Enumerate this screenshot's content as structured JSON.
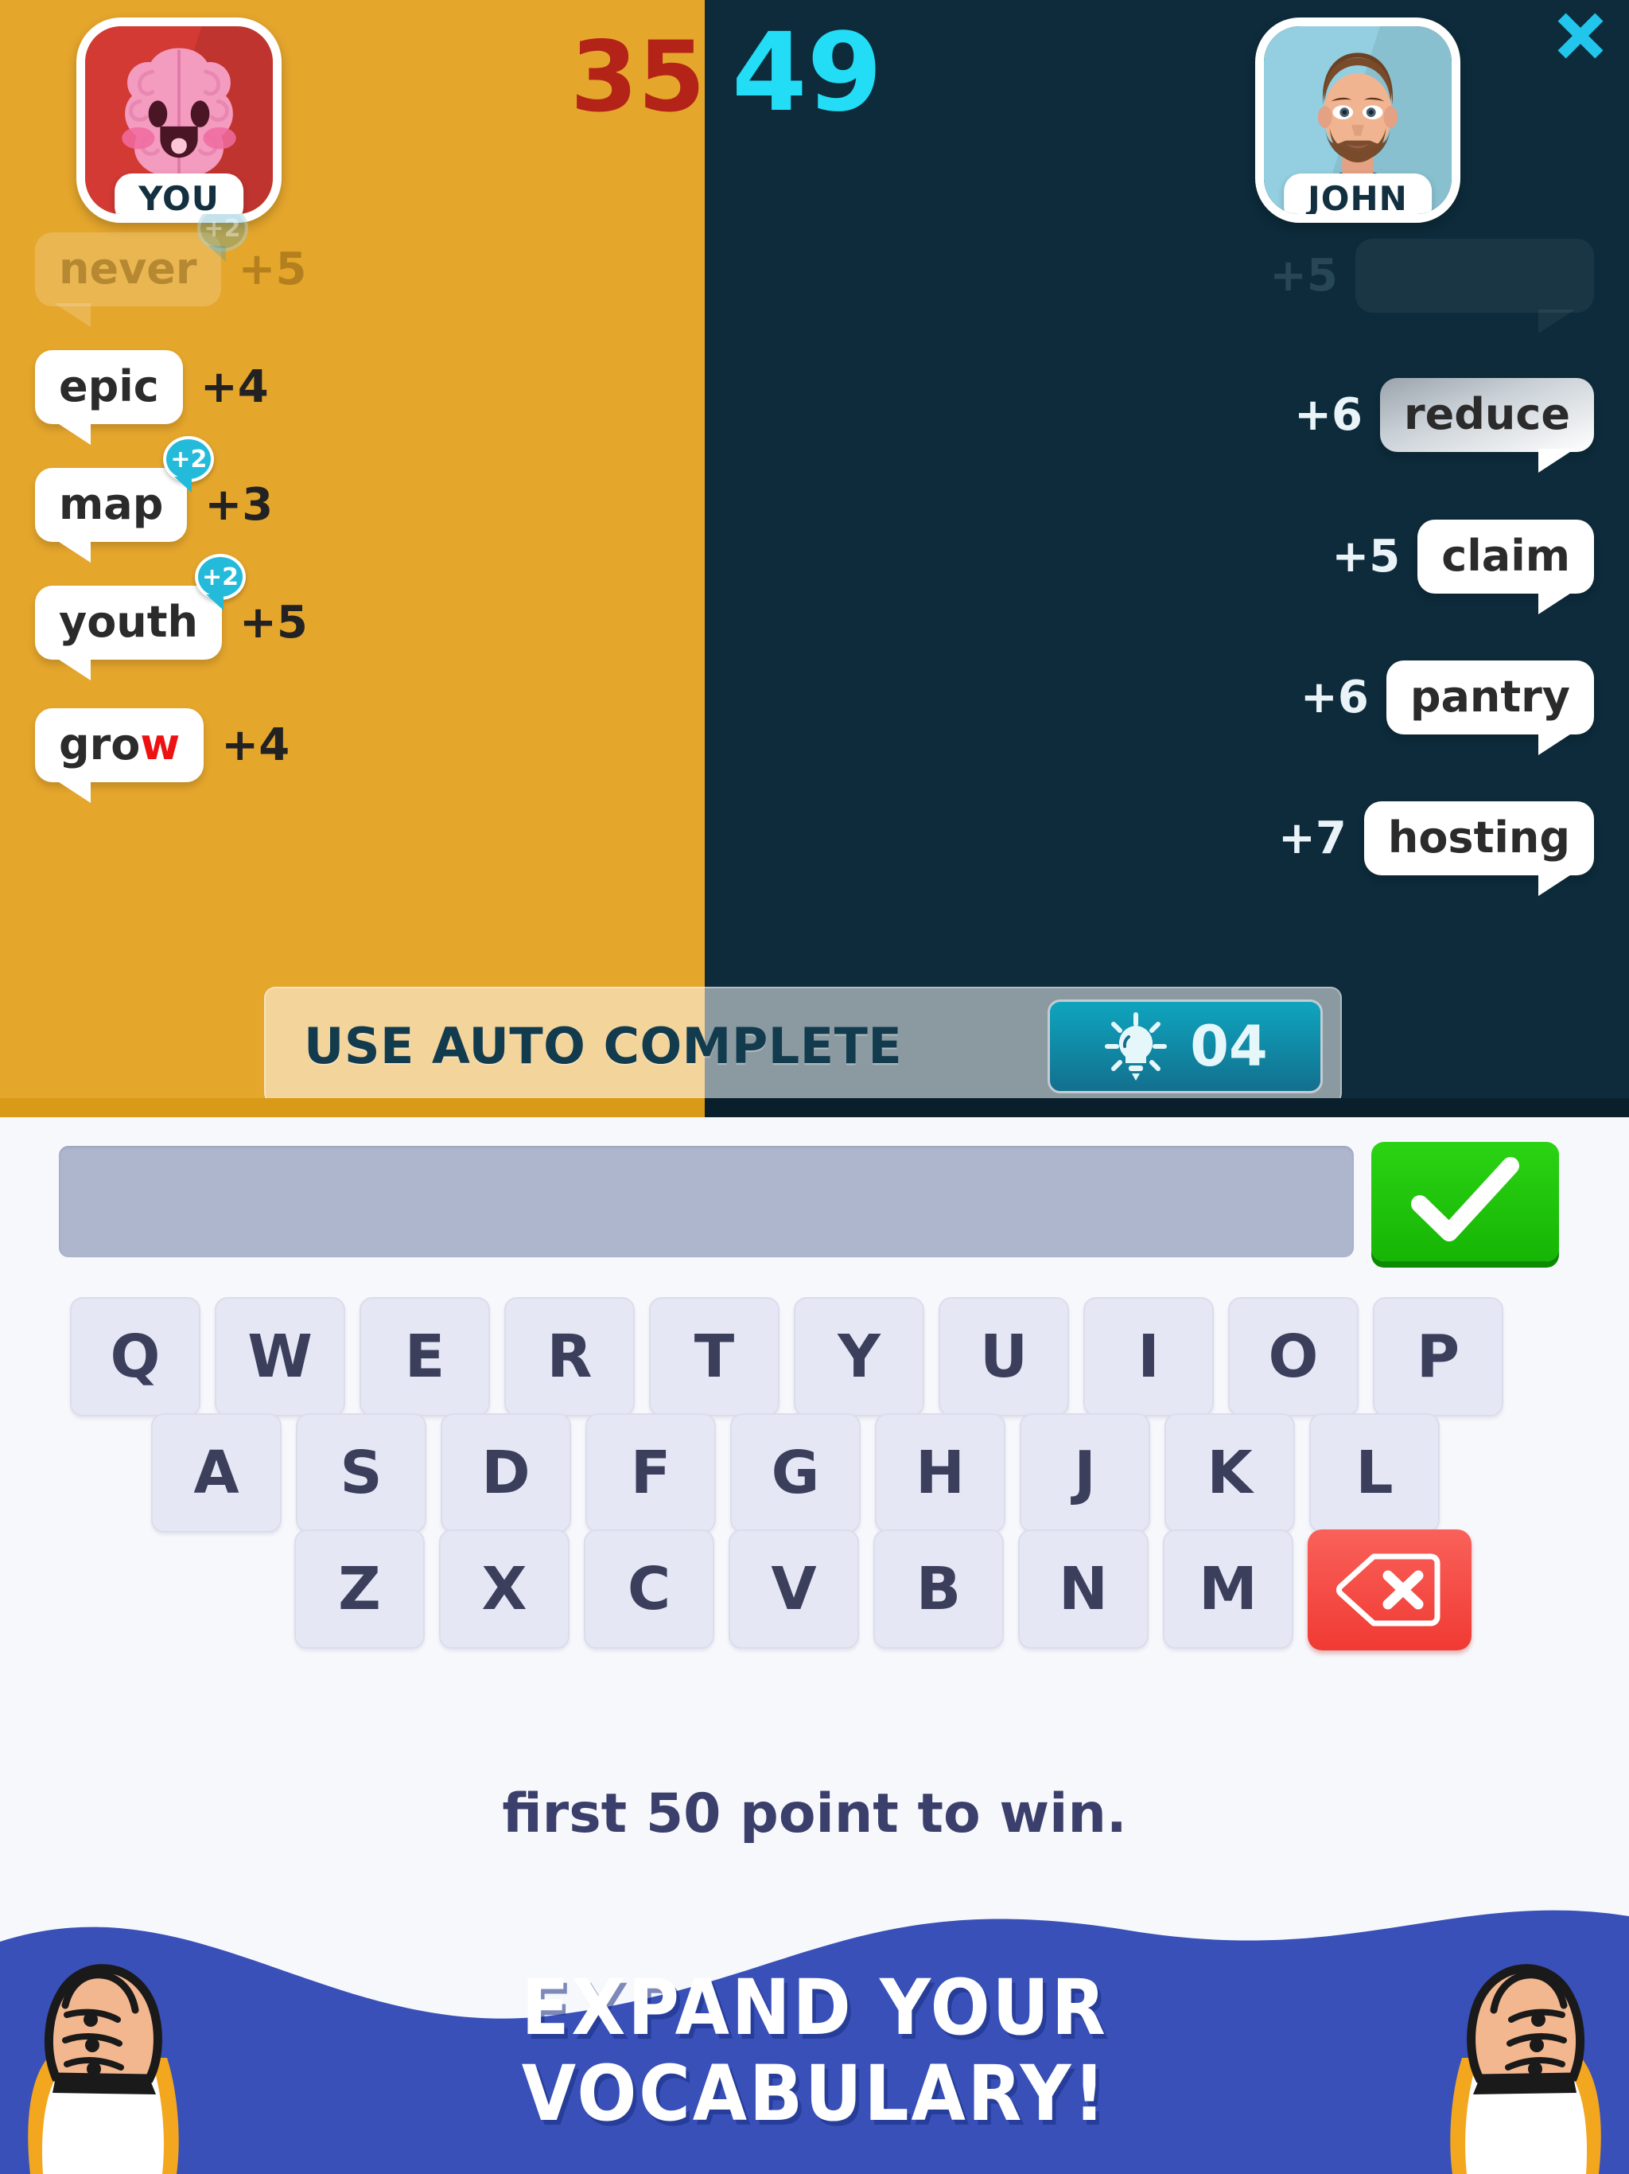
{
  "header": {
    "player_score": "35",
    "opponent_score": "49",
    "player_name": "YOU",
    "opponent_name": "JOHN",
    "close_icon": "close-x-icon"
  },
  "colors": {
    "player_side_bg": "#E5A62C",
    "opponent_side_bg": "#0D2B3B",
    "player_score": "#B32318",
    "opponent_score": "#22DDF5",
    "bonus_badge": "#23BBD9",
    "submit_green": "#16B505",
    "backspace_red": "#F03A33",
    "banner_blue": "#3950B8",
    "hint_badge_teal": "#0FA4BE",
    "key_face": "#E6E7F5",
    "key_text": "#3B3F5C",
    "input_fill": "#AEB6CE",
    "highlight_letter": "#EE1111"
  },
  "player_words": [
    {
      "word": "never",
      "prefix": "never",
      "suffix": "",
      "points": "+5",
      "bonus": "+2",
      "state": "expiring"
    },
    {
      "word": "epic",
      "prefix": "epic",
      "suffix": "",
      "points": "+4",
      "bonus": "",
      "state": "active"
    },
    {
      "word": "map",
      "prefix": "map",
      "suffix": "",
      "points": "+3",
      "bonus": "+2",
      "state": "active"
    },
    {
      "word": "youth",
      "prefix": "youth",
      "suffix": "",
      "points": "+5",
      "bonus": "+2",
      "state": "active"
    },
    {
      "word": "grow",
      "prefix": "gro",
      "suffix": "w",
      "points": "+4",
      "bonus": "",
      "state": "active"
    }
  ],
  "opponent_words": [
    {
      "word": "",
      "prefix": "",
      "points": "+5",
      "state": "expiring"
    },
    {
      "word": "reduce",
      "prefix": "reduce",
      "points": "+6",
      "state": "fading"
    },
    {
      "word": "claim",
      "prefix": "claim",
      "points": "+5",
      "state": "active"
    },
    {
      "word": "pantry",
      "prefix": "pantry",
      "points": "+6",
      "state": "active"
    },
    {
      "word": "hosting",
      "prefix": "hosting",
      "points": "+7",
      "state": "active"
    }
  ],
  "auto_complete": {
    "label": "USE AUTO COMPLETE",
    "hint_icon": "lightbulb-icon",
    "hint_count": "04"
  },
  "answer": {
    "value": "",
    "placeholder": "",
    "submit_icon": "checkmark-icon"
  },
  "keyboard": {
    "row1": [
      "Q",
      "W",
      "E",
      "R",
      "T",
      "Y",
      "U",
      "I",
      "O",
      "P"
    ],
    "row2": [
      "A",
      "S",
      "D",
      "F",
      "G",
      "H",
      "J",
      "K",
      "L"
    ],
    "row3": [
      "Z",
      "X",
      "C",
      "V",
      "B",
      "N",
      "M"
    ],
    "backspace_icon": "backspace-x-icon"
  },
  "footer_hint": "first 50 point to win.",
  "banner": {
    "line1": "EXPAND YOUR",
    "line2": "VOCABULARY!",
    "left_icon": "raised-fist-icon",
    "right_icon": "raised-fist-icon"
  }
}
